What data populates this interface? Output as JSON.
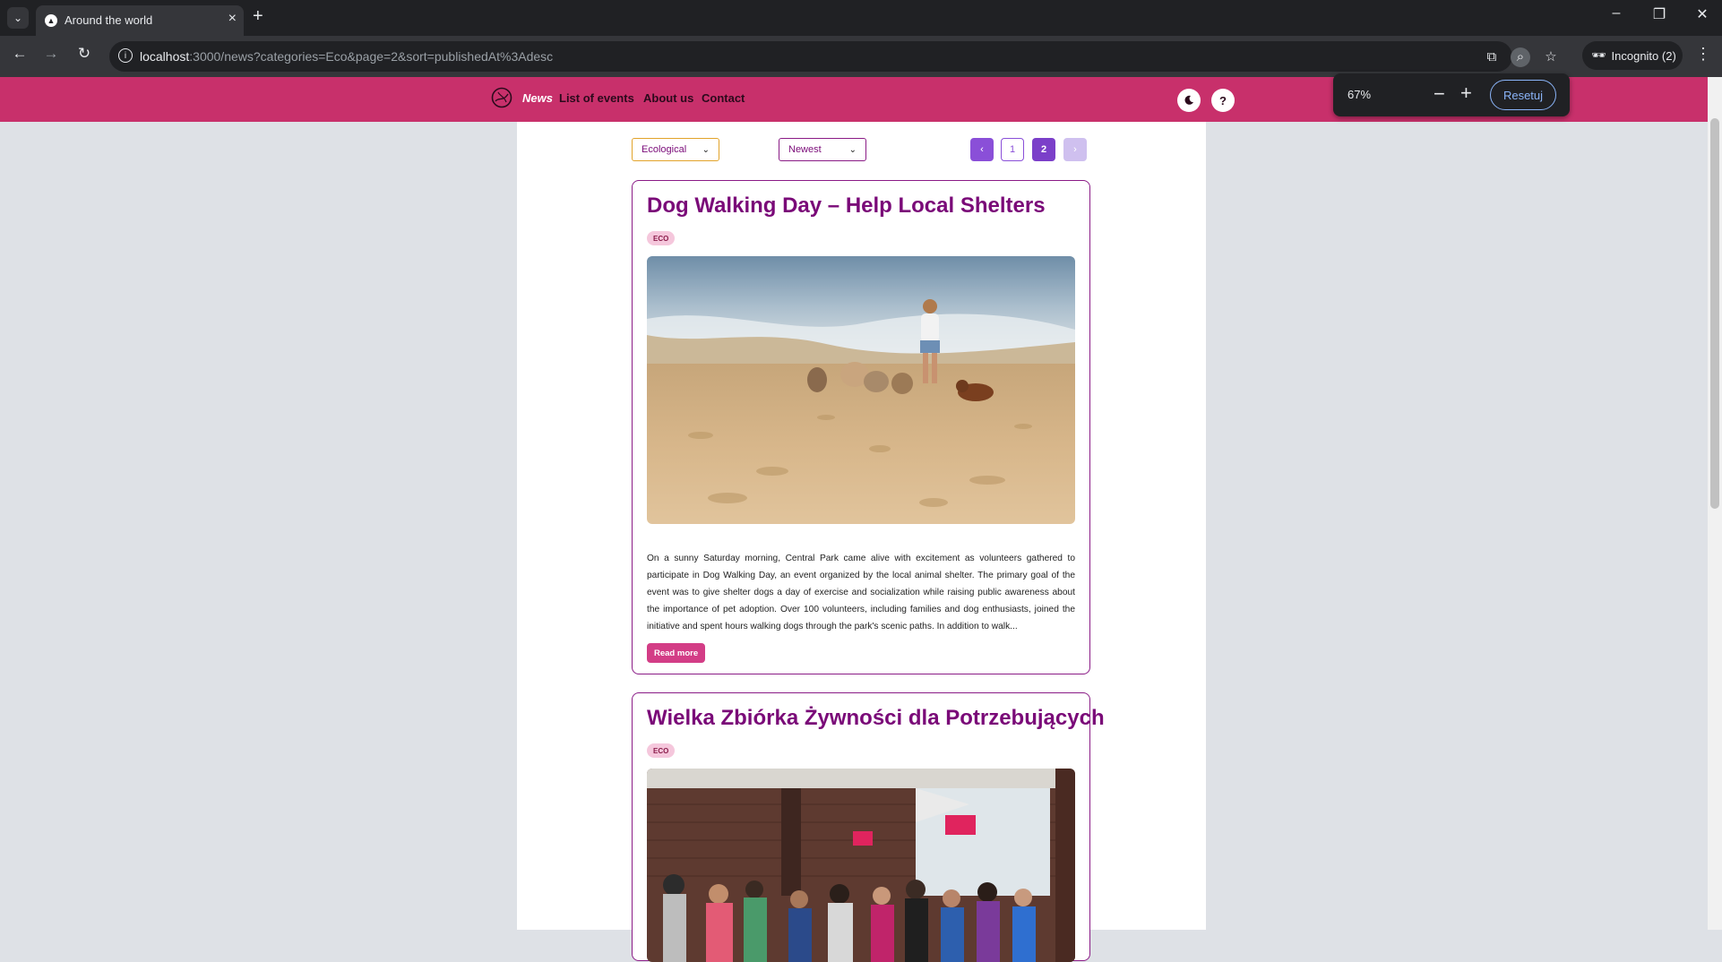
{
  "browser": {
    "tab_title": "Around the world",
    "url_host": "localhost",
    "url_rest": ":3000/news?categories=Eco&page=2&sort=publishedAt%3Adesc",
    "incognito_label": "Incognito (2)"
  },
  "zoom_popup": {
    "value": "67%",
    "minus": "−",
    "plus": "+",
    "reset_label": "Resetuj"
  },
  "header": {
    "nav": [
      "News",
      "List of events",
      "About us",
      "Contact"
    ],
    "help": "?"
  },
  "filters": {
    "category": "Ecological",
    "sort": "Newest"
  },
  "pagination": {
    "prev": "‹",
    "pages": [
      "1",
      "2"
    ],
    "current": "2",
    "next": "›"
  },
  "articles": [
    {
      "title": "Dog Walking Day – Help Local Shelters",
      "badge": "ECO",
      "excerpt": "On a sunny Saturday morning, Central Park came alive with excitement as volunteers gathered to participate in Dog Walking Day, an event organized by the local animal shelter. The primary goal of the event was to give shelter dogs a day of exercise and socialization while raising public awareness about the importance of pet adoption. Over 100 volunteers, including families and dog enthusiasts, joined the initiative and spent hours walking dogs through the park's scenic paths. In addition to walk...",
      "read_more": "Read more"
    },
    {
      "title": "Wielka Zbiórka Żywności dla Potrzebujących",
      "badge": "ECO"
    }
  ],
  "colors": {
    "header": "#c8306b",
    "accent": "#8a1b86",
    "pagination": "#7b3fc9",
    "read_more": "#d33d86"
  }
}
